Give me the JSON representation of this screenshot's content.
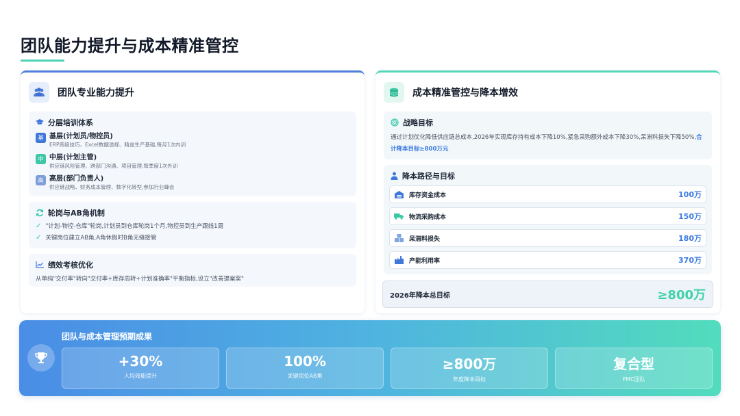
{
  "page": {
    "title": "团队能力提升与成本精准管控"
  },
  "colors": {
    "blue_accent": "#4f7fdb",
    "teal_accent": "#54d6b8",
    "highlight": "#3b7be0",
    "green_value": "#3fd2a8"
  },
  "left": {
    "title": "团队专业能力提升",
    "training": {
      "title": "分层培训体系",
      "tiers": [
        {
          "badge": "基",
          "name": "基层(计划员/物控员)",
          "desc": "ERP高级技巧、Excel数据透视、精益生产基础,每月1次内训",
          "color": "#3f78d8"
        },
        {
          "badge": "中",
          "name": "中层(计划主管)",
          "desc": "供应链风险管理、跨部门沟通、项目管理,每季度1次外训",
          "color": "#3cc8a6"
        },
        {
          "badge": "高",
          "name": "高层(部门负责人)",
          "desc": "供应链战略、财务成本管理、数字化转型,参加行业峰会",
          "color": "#7f9fd8"
        }
      ]
    },
    "rotation": {
      "title": "轮岗与AB角机制",
      "items": [
        "\"计划-物控-仓库\"轮岗,计划员到仓库轮岗1个月,物控员到生产跟线1周",
        "关键岗位建立AB角,A角休假时B角无缝接管"
      ]
    },
    "performance": {
      "title": "绩效考核优化",
      "text": "从单纯\"交付率\"转向\"交付率+库存周转+计划准确率\"平衡指标,设立\"改善提案奖\""
    }
  },
  "right": {
    "title": "成本精准管控与降本增效",
    "strategy": {
      "title": "战略目标",
      "text": "通过计划优化降低供应链总成本,2026年实现库存持有成本下降10%,紧急采购额外成本下降30%,呆滞料损失下降50%,",
      "highlight": "合计降本目标≥800万元"
    },
    "routes": {
      "title": "降本路径与目标",
      "items": [
        {
          "icon": "warehouse-icon",
          "label": "库存资金成本",
          "value": "100万"
        },
        {
          "icon": "truck-icon",
          "label": "物流采购成本",
          "value": "150万"
        },
        {
          "icon": "boxes-icon",
          "label": "呆滞料损失",
          "value": "180万"
        },
        {
          "icon": "factory-icon",
          "label": "产能利用率",
          "value": "370万"
        }
      ]
    },
    "total": {
      "label": "2026年降本总目标",
      "value": "≥800万"
    }
  },
  "banner": {
    "title": "团队与成本管理预期成果",
    "stats": [
      {
        "value": "+30%",
        "label": "人均效能提升"
      },
      {
        "value": "100%",
        "label": "关键岗位AB角"
      },
      {
        "value": "≥800万",
        "label": "年度降本目标"
      },
      {
        "value": "复合型",
        "label": "PMC团队"
      }
    ]
  }
}
